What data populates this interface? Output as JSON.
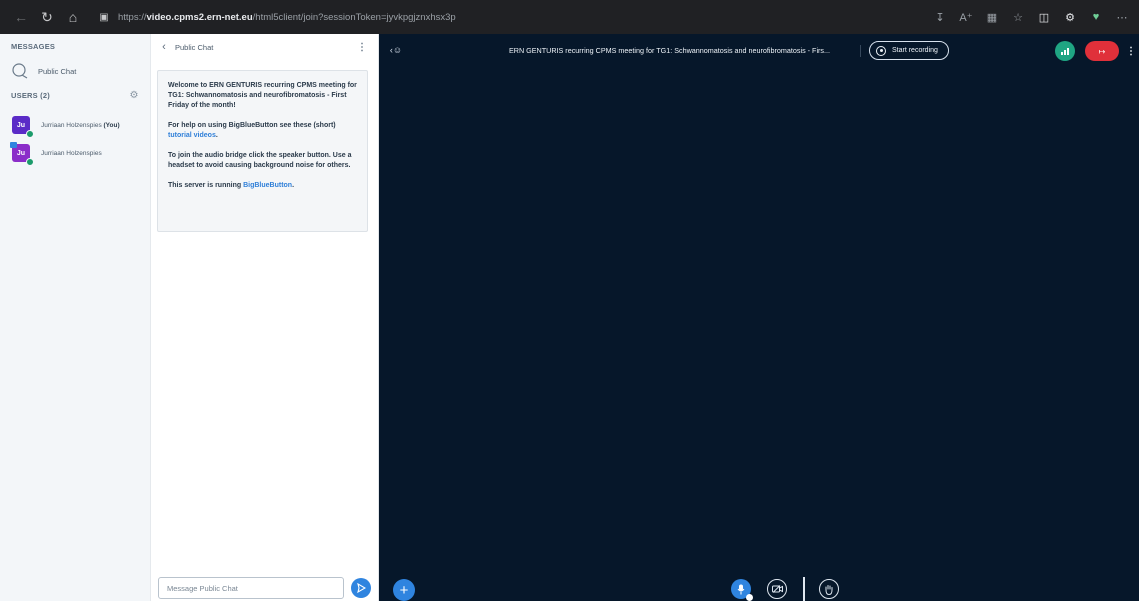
{
  "browser": {
    "url_scheme": "https://",
    "url_host": "video.cpms2.ern-net.eu",
    "url_path": "/html5client/join?sessionToken=jyvkpgjznxhsx3p"
  },
  "sidebar": {
    "messages_label": "MESSAGES",
    "public_chat_label": "Public Chat",
    "users_label": "USERS (2)",
    "users": [
      {
        "initials": "Ju",
        "name": "Jurriaan Holzenspies",
        "you": "(You)"
      },
      {
        "initials": "Ju",
        "name": "Jurriaan Holzenspies"
      }
    ]
  },
  "chat": {
    "title": "Public Chat",
    "welcome_line1": "Welcome to ERN GENTURIS recurring CPMS meeting for TG1: Schwannomatosis and neurofibromatosis - First Friday of the month!",
    "help_prefix": "For help on using BigBlueButton see these (short)",
    "help_link": "tutorial videos",
    "help_suffix": ".",
    "audio_text": "To join the audio bridge click the speaker button. Use a headset to avoid causing background noise for others.",
    "server_prefix": "This server is running",
    "server_link": "BigBlueButton",
    "server_suffix": ".",
    "input_placeholder": "Message Public Chat"
  },
  "main": {
    "meeting_title": "ERN GENTURIS recurring CPMS meeting for TG1: Schwannomatosis and neurofibromatosis - Firs...",
    "record_label": "Start recording"
  },
  "colors": {
    "accent": "#2f84df",
    "presentation_bg": "#06172a",
    "leave": "#e0303a",
    "connection": "#1fa583"
  }
}
